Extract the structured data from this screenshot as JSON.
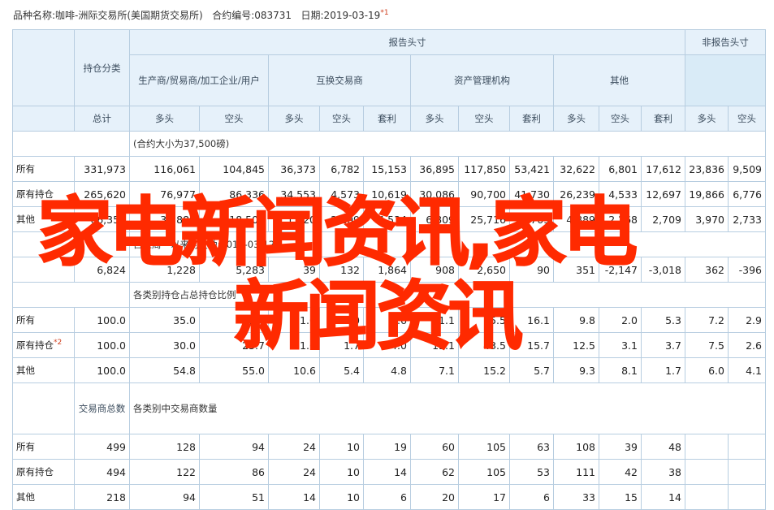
{
  "report": {
    "title": "品种名称:咖啡-洲际交易所(美国期货交易所)",
    "code": "合约编号:083731",
    "date": "日期:2019-03-19",
    "note_mark": "*1"
  },
  "headers": {
    "reporting": "报告头寸",
    "nonreporting": "非报告头寸",
    "position_class": "持仓分类",
    "producer": "生产商/贸易商/加工企业/用户",
    "swap": "互换交易商",
    "managed": "资产管理机构",
    "other": "其他",
    "total": "总计",
    "long": "多头",
    "short": "空头",
    "spread": "套利"
  },
  "sections": {
    "contract_unit": "(合约大小为37,500磅)",
    "change": "自上周一以来的变动:2019-03-12",
    "percent": "各类别持仓占总持仓比例",
    "traders_label": "交易商总数",
    "traders_desc": "各类别中交易商数量"
  },
  "rows": {
    "all": "所有",
    "old": "原有持仓",
    "old_note": "*2",
    "other": "其他"
  },
  "positions": [
    [
      "331,973",
      "116,061",
      "104,845",
      "36,373",
      "6,782",
      "15,153",
      "36,895",
      "117,850",
      "53,421",
      "32,622",
      "6,801",
      "17,612",
      "23,836",
      "9,509"
    ],
    [
      "265,620",
      "76,977",
      "86,336",
      "34,553",
      "4,573",
      "10,619",
      "30,086",
      "90,700",
      "41,730",
      "26,239",
      "4,533",
      "12,697",
      "19,866",
      "6,776"
    ],
    [
      "66,353",
      "36,888",
      "18,509",
      "1,820",
      "2,209",
      "4,534",
      "6,809",
      "25,716",
      "3,769",
      "4,889",
      "2,268",
      "2,709",
      "3,970",
      "2,733"
    ]
  ],
  "changes": [
    "6,824",
    "1,228",
    "5,283",
    "39",
    "132",
    "1,864",
    "908",
    "2,650",
    "90",
    "351",
    "-2,147",
    "-3,018",
    "362",
    "-396"
  ],
  "percents": [
    [
      "100.0",
      "35.0",
      "31.6",
      "11.0",
      "2.0",
      "4.6",
      "11.1",
      "35.5",
      "16.1",
      "9.8",
      "2.0",
      "5.3",
      "7.2",
      "2.9"
    ],
    [
      "100.0",
      "30.0",
      "25.7",
      "11.6",
      "1.7",
      "4.0",
      "15.1",
      "43.5",
      "15.7",
      "12.5",
      "3.1",
      "3.7",
      "7.5",
      "2.6"
    ],
    [
      "100.0",
      "54.8",
      "55.0",
      "10.6",
      "5.4",
      "4.8",
      "7.1",
      "15.2",
      "5.7",
      "9.3",
      "8.1",
      "1.7",
      "6.0",
      "4.1"
    ]
  ],
  "traders": [
    [
      "499",
      "128",
      "94",
      "24",
      "10",
      "19",
      "60",
      "105",
      "63",
      "108",
      "39",
      "48"
    ],
    [
      "494",
      "122",
      "86",
      "24",
      "10",
      "14",
      "62",
      "105",
      "53",
      "111",
      "42",
      "38"
    ],
    [
      "218",
      "94",
      "51",
      "14",
      "10",
      "6",
      "20",
      "17",
      "6",
      "33",
      "15",
      "14"
    ]
  ],
  "overlay": {
    "line1": "家电新闻资讯,家电",
    "line2": "新闻资讯"
  }
}
